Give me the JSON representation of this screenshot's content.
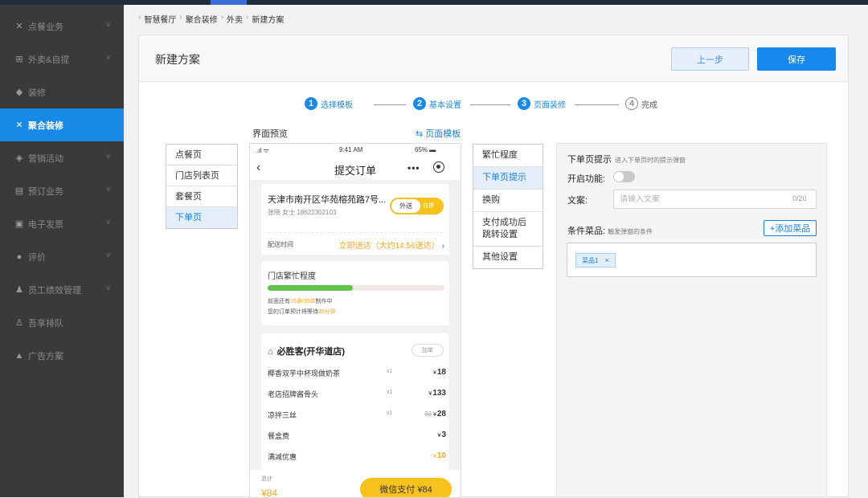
{
  "sidebar": {
    "items": [
      {
        "icon": "utensils-icon",
        "glyph": "✕",
        "label": "点餐业务"
      },
      {
        "icon": "takeout-icon",
        "glyph": "⊞",
        "label": "外卖&自提"
      },
      {
        "icon": "decorate-icon",
        "glyph": "◆",
        "label": "装修"
      },
      {
        "icon": "aggregate-icon",
        "glyph": "✕",
        "label": "聚合装修"
      },
      {
        "icon": "marketing-icon",
        "glyph": "◈",
        "label": "营销活动"
      },
      {
        "icon": "reserve-icon",
        "glyph": "▤",
        "label": "预订业务"
      },
      {
        "icon": "invoice-icon",
        "glyph": "▣",
        "label": "电子发票"
      },
      {
        "icon": "comment-icon",
        "glyph": "●",
        "label": "评价"
      },
      {
        "icon": "staff-icon",
        "glyph": "♟",
        "label": "员工绩效管理"
      },
      {
        "icon": "queue-icon",
        "glyph": "♙",
        "label": "吾享排队"
      },
      {
        "icon": "ad-icon",
        "glyph": "▲",
        "label": "广告方案"
      }
    ],
    "active_index": 3
  },
  "breadcrumb": [
    "智慧餐厅",
    "聚合装修",
    "外卖",
    "新建方案"
  ],
  "panel": {
    "title": "新建方案",
    "prev_label": "上一步",
    "save_label": "保存"
  },
  "steps": [
    {
      "num": "1",
      "label": "选择模板",
      "done": true
    },
    {
      "num": "2",
      "label": "基本设置",
      "done": true
    },
    {
      "num": "3",
      "label": "页面装修",
      "done": true
    },
    {
      "num": "4",
      "label": "完成",
      "done": false
    }
  ],
  "pages": {
    "items": [
      "点餐页",
      "门店列表页",
      "套餐页",
      "下单页"
    ],
    "active": "下单页"
  },
  "preview": {
    "label": "界面预览",
    "template_link": "⇆ 页面模板"
  },
  "phone": {
    "status": {
      "signal": "..ıl ᯤ",
      "time": "9:41 AM",
      "battery": "65% ▬"
    },
    "nav_title": "提交订单",
    "address": {
      "line1": "天津市南开区华苑榕苑路7号...",
      "line2": "张晓 女士  18622302103",
      "toggle_on": "外送",
      "toggle_off": "自提",
      "delivery_label": "配送时间",
      "delivery_value": "立即送达（大约14:56送达）",
      "delivery_arrow": "›"
    },
    "busy": {
      "title": "门店繁忙程度",
      "level": 0.48,
      "note1_a": "前面还有",
      "note1_b": "18桌/35单",
      "note1_c": "制作中",
      "note2_a": "您的订单预计将等待",
      "note2_b": "35分钟"
    },
    "order": {
      "shop": "必胜客(开华道店)",
      "add": "加单",
      "items": [
        {
          "name": "椰香双芋中杯现做奶茶",
          "qty": "x1",
          "price": "18",
          "old": ""
        },
        {
          "name": "老店招牌酱骨头",
          "qty": "x1",
          "price": "133",
          "old": ""
        },
        {
          "name": "凉拌三丝",
          "qty": "x1",
          "price": "28",
          "old": "32"
        },
        {
          "name": "餐盒费",
          "qty": "",
          "price": "3",
          "old": ""
        },
        {
          "name": "满减优惠",
          "qty": "",
          "price": "10",
          "old": ""
        }
      ],
      "currency": "¥",
      "minus": "-"
    },
    "pay": {
      "total_label": "总计",
      "total": "¥84",
      "button": "微信支付 ¥84"
    }
  },
  "menu2": {
    "items": [
      "繁忙程度",
      "下单页提示",
      "换购",
      "支付成功后\n跳转设置",
      "其他设置"
    ],
    "active": "下单页提示"
  },
  "settings": {
    "title": "下单页提示",
    "subtitle": "进入下单页时的提示弹窗",
    "enable_label": "开启功能:",
    "enabled": false,
    "text_label": "文案:",
    "text_placeholder": "请输入文案",
    "text_value": "",
    "counter": "0/20",
    "dish_label": "条件菜品:",
    "dish_hint": "触发弹窗的条件",
    "add_dish": "+添加菜品",
    "tags": [
      "菜品1"
    ],
    "tag_remove": "×"
  },
  "colors": {
    "accent": "#1788ec",
    "sidebar_bg": "#3a3a3a",
    "yellow": "#f8c21d",
    "green": "#62c24b"
  }
}
